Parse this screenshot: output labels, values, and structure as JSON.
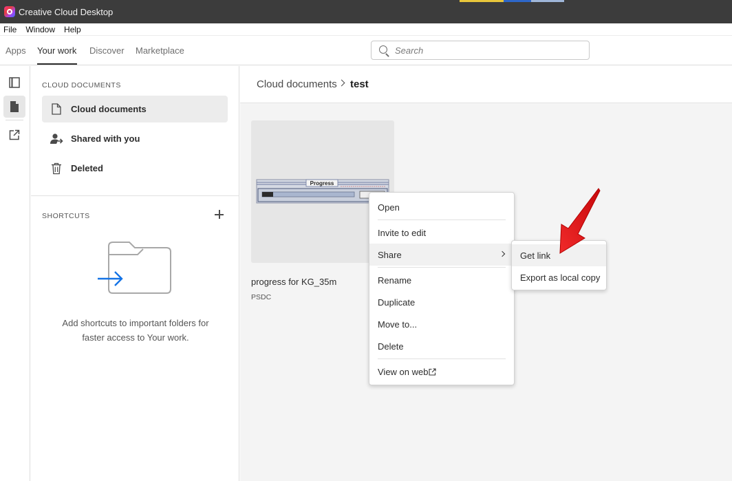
{
  "window": {
    "title": "Creative Cloud Desktop"
  },
  "menu": [
    "File",
    "Window",
    "Help"
  ],
  "tabs": [
    {
      "label": "Apps",
      "active": false
    },
    {
      "label": "Your work",
      "active": true
    },
    {
      "label": "Discover",
      "active": false
    },
    {
      "label": "Marketplace",
      "active": false
    }
  ],
  "search": {
    "placeholder": "Search"
  },
  "rail": {
    "icons": [
      "panel-icon",
      "document-icon",
      "external-link-icon"
    ]
  },
  "sidebar": {
    "cloud_section_label": "CLOUD DOCUMENTS",
    "items": [
      {
        "label": "Cloud documents",
        "icon": "document-icon",
        "active": true
      },
      {
        "label": "Shared with you",
        "icon": "shared-users-icon",
        "active": false
      },
      {
        "label": "Deleted",
        "icon": "trash-icon",
        "active": false
      }
    ],
    "shortcuts_label": "SHORTCUTS",
    "empty_text": "Add shortcuts to important folders for faster access to Your work."
  },
  "breadcrumb": {
    "parent": "Cloud documents",
    "current": "test"
  },
  "file": {
    "name": "progress for KG_35m",
    "type": "PSDC",
    "thumbnail_text": "Progress"
  },
  "context_menu": {
    "items": [
      "Open",
      "Invite to edit",
      "Share",
      "Rename",
      "Duplicate",
      "Move to...",
      "Delete",
      "View on web"
    ],
    "hovered": "Share"
  },
  "share_submenu": {
    "items": [
      "Get link",
      "Export as local copy"
    ],
    "hovered": "Get link"
  },
  "colors": {
    "accent_blue": "#1473e6",
    "annotation_red": "#e8191c",
    "titlebar": "#3c3c3c"
  }
}
